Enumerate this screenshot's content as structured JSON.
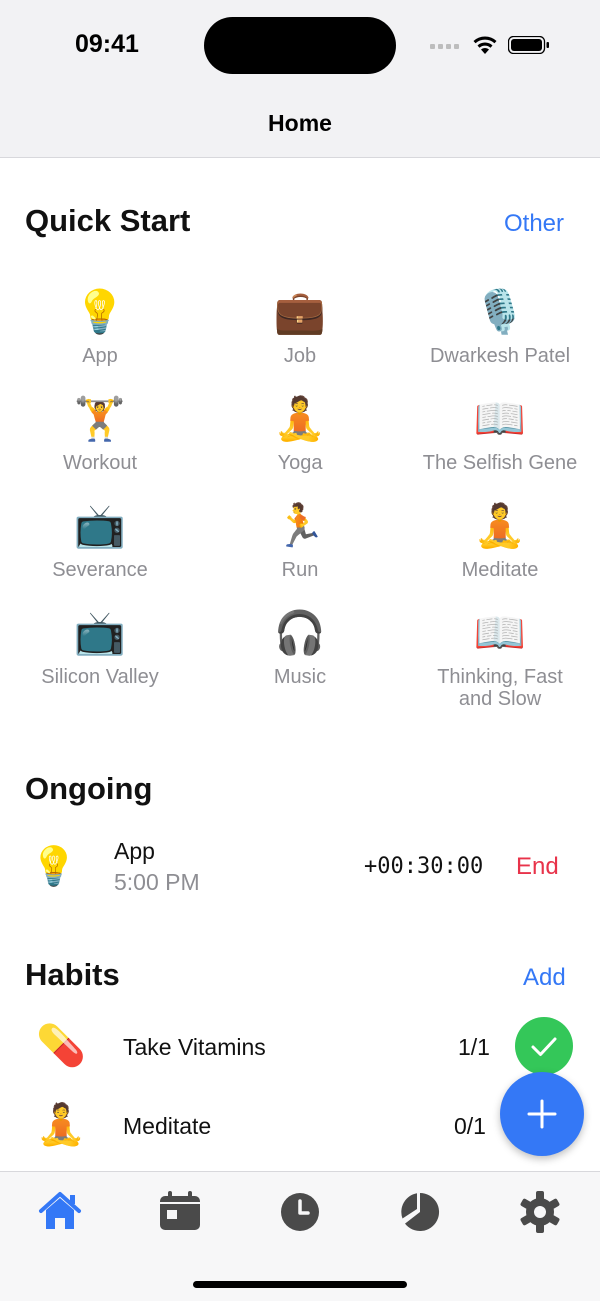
{
  "status": {
    "time": "09:41"
  },
  "nav": {
    "title": "Home"
  },
  "quick_start": {
    "title": "Quick Start",
    "action": "Other",
    "items": [
      {
        "icon": "💡",
        "icon_name": "lightbulb-icon",
        "label": "App"
      },
      {
        "icon": "💼",
        "icon_name": "briefcase-icon",
        "label": "Job"
      },
      {
        "icon": "🎙️",
        "icon_name": "microphone-icon",
        "label": "Dwarkesh Patel"
      },
      {
        "icon": "🏋️",
        "icon_name": "weightlifter-icon",
        "label": "Workout"
      },
      {
        "icon": "🧘",
        "icon_name": "meditation-icon",
        "label": "Yoga"
      },
      {
        "icon": "📖",
        "icon_name": "open-book-icon",
        "label": "The Selfish Gene"
      },
      {
        "icon": "📺",
        "icon_name": "television-icon",
        "label": "Severance"
      },
      {
        "icon": "🏃",
        "icon_name": "runner-icon",
        "label": "Run"
      },
      {
        "icon": "🧘",
        "icon_name": "meditation-icon",
        "label": "Meditate"
      },
      {
        "icon": "📺",
        "icon_name": "television-icon",
        "label": "Silicon Valley"
      },
      {
        "icon": "🎧",
        "icon_name": "headphones-icon",
        "label": "Music"
      },
      {
        "icon": "📖",
        "icon_name": "open-book-icon",
        "label": "Thinking, Fast and Slow"
      }
    ]
  },
  "ongoing": {
    "title": "Ongoing",
    "item": {
      "icon": "💡",
      "name": "App",
      "start_time": "5:00 PM",
      "duration": "+00:30:00",
      "end_label": "End"
    }
  },
  "habits": {
    "title": "Habits",
    "action": "Add",
    "items": [
      {
        "icon": "💊",
        "icon_name": "pill-icon",
        "name": "Take Vitamins",
        "count": "1/1"
      },
      {
        "icon": "🧘",
        "icon_name": "meditation-icon",
        "name": "Meditate",
        "count": "0/1"
      }
    ]
  },
  "colors": {
    "accent": "#3478f6",
    "danger": "#e8334a",
    "success": "#34c759",
    "secondary_text": "#8e8e93",
    "tab_inactive": "#4a4a4a"
  },
  "tabs": [
    {
      "name": "home",
      "active": true
    },
    {
      "name": "calendar",
      "active": false
    },
    {
      "name": "clock",
      "active": false
    },
    {
      "name": "stats",
      "active": false
    },
    {
      "name": "settings",
      "active": false
    }
  ]
}
